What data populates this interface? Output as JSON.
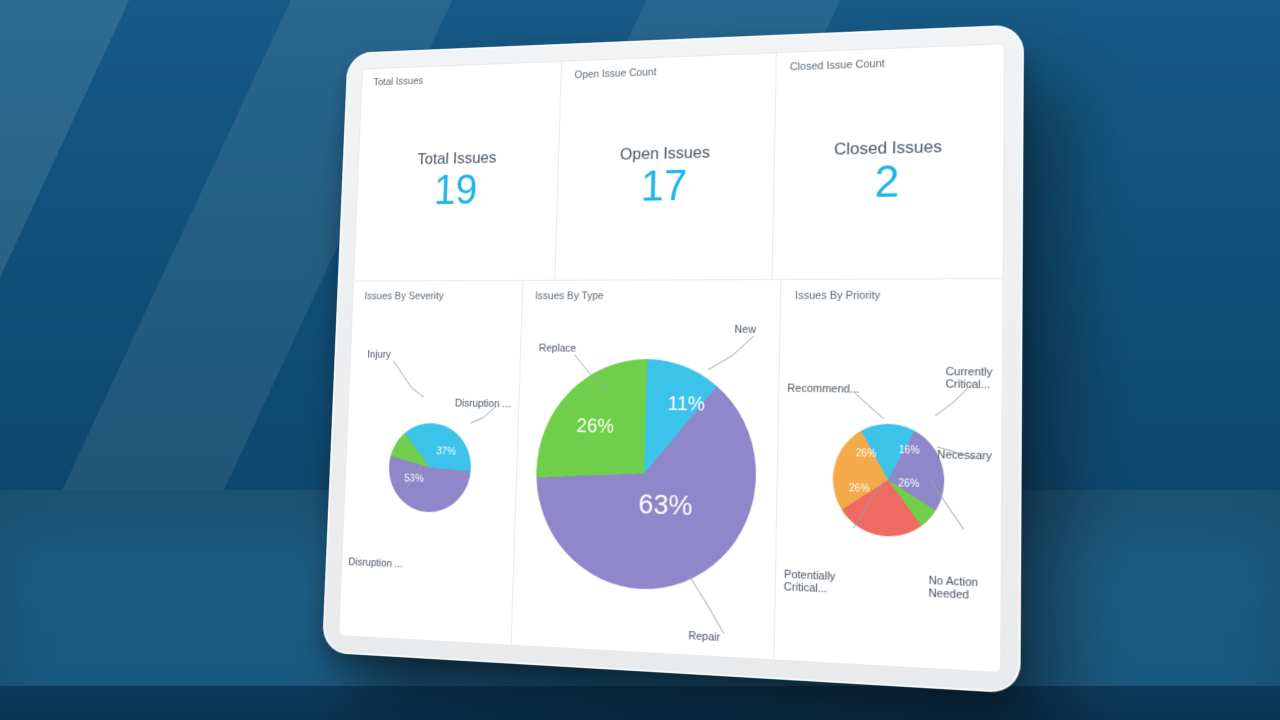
{
  "stats": {
    "total": {
      "card_title": "Total Issues",
      "label": "Total Issues",
      "value": "19"
    },
    "open": {
      "card_title": "Open Issue Count",
      "label": "Open Issues",
      "value": "17"
    },
    "closed": {
      "card_title": "Closed Issue Count",
      "label": "Closed Issues",
      "value": "2"
    }
  },
  "severity": {
    "card_title": "Issues By Severity",
    "labels": {
      "injury": "Injury",
      "disruption_a": "Disruption ...",
      "disruption_b": "Disruption ..."
    },
    "pct": {
      "injury": "",
      "disruption_a": "37%",
      "disruption_b": "53%"
    }
  },
  "type": {
    "card_title": "Issues By Type",
    "labels": {
      "new": "New",
      "repair": "Repair",
      "replace": "Replace"
    },
    "pct": {
      "new": "11%",
      "repair": "63%",
      "replace": "26%"
    }
  },
  "priority": {
    "card_title": "Issues By Priority",
    "labels": {
      "recommend": "Recommend...",
      "currently_critical": "Currently\nCritical...",
      "necessary": "Necessary",
      "no_action": "No Action\nNeeded",
      "potentially_critical": "Potentially\nCritical..."
    },
    "pct": {
      "recommend": "26%",
      "currently_critical": "16%",
      "necessary": "26%",
      "no_action": "",
      "potentially_critical": "26%"
    }
  },
  "colors": {
    "cyan": "#3cc3ea",
    "purple": "#8f87c9",
    "green": "#6fcf4b",
    "orange": "#f4a94b",
    "red": "#ef6a63",
    "accent": "#1fb5e8"
  },
  "chart_data": [
    {
      "type": "pie",
      "title": "Issues By Severity",
      "series": [
        {
          "name": "Severity",
          "values": [
            37,
            53,
            10
          ]
        }
      ],
      "categories": [
        "Disruption ...",
        "Disruption ...",
        "Injury"
      ]
    },
    {
      "type": "pie",
      "title": "Issues By Type",
      "series": [
        {
          "name": "Type",
          "values": [
            11,
            63,
            26
          ]
        }
      ],
      "categories": [
        "New",
        "Repair",
        "Replace"
      ]
    },
    {
      "type": "pie",
      "title": "Issues By Priority",
      "series": [
        {
          "name": "Priority",
          "values": [
            16,
            26,
            6,
            26,
            26
          ]
        }
      ],
      "categories": [
        "Currently Critical...",
        "Necessary",
        "No Action Needed",
        "Potentially Critical...",
        "Recommend..."
      ]
    }
  ]
}
